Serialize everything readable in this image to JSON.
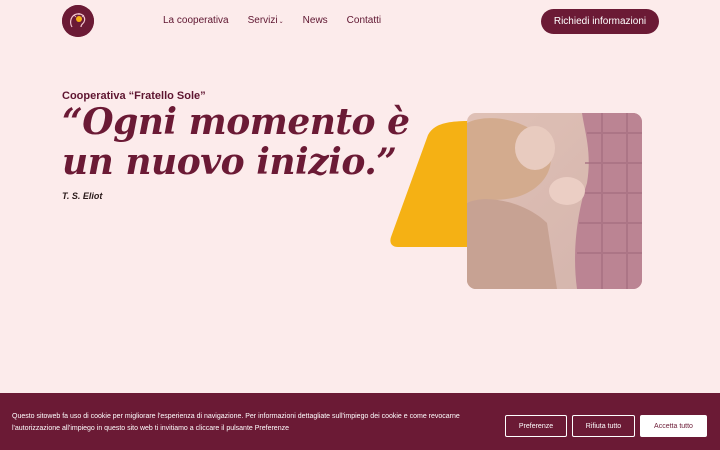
{
  "header": {
    "nav": [
      {
        "label": "La cooperativa"
      },
      {
        "label": "Servizi",
        "has_dropdown": true
      },
      {
        "label": "News"
      },
      {
        "label": "Contatti"
      }
    ],
    "cta_label": "Richiedi informazioni"
  },
  "hero": {
    "eyebrow": "Cooperativa “Fratello Sole”",
    "quote": "“Ogni momento è un nuovo inizio.”",
    "author": "T. S. Eliot"
  },
  "cookie": {
    "text": "Questo sitoweb fa uso di cookie per migliorare l'esperienza di navigazione. Per informazioni dettagliate sull'impiego dei cookie e come revocarne l'autorizzazione all'impiego in questo sito web ti invitiamo a cliccare il pulsante Preferenze",
    "preferences_label": "Preferenze",
    "reject_label": "Rifiuta tutto",
    "accept_label": "Accetta tutto"
  },
  "colors": {
    "background": "#fcebeb",
    "brand": "#6b1a35",
    "accent_yellow": "#f5b114"
  }
}
